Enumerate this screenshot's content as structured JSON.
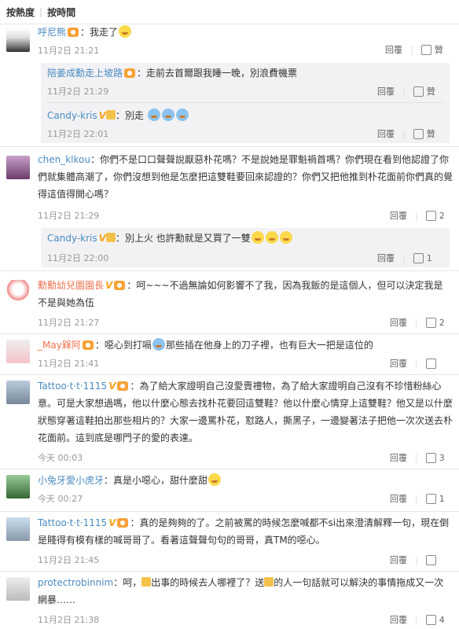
{
  "sort": {
    "hot": "按熱度",
    "time": "按時間"
  },
  "actions": {
    "reply": "回覆",
    "like": "贊"
  },
  "comments": [
    {
      "user": "呼尼熊",
      "text": "：我走了",
      "time": "11月2日 21:21",
      "likes": ""
    },
    {
      "user": "陪姜成勳走上坡路",
      "text": "：走前去首爾跟我睡一晚，別浪費機票",
      "time": "11月2日 21:29",
      "likes": ""
    },
    {
      "user": "Candy-kris",
      "text": "：別走",
      "time": "11月2日 22:01",
      "likes": ""
    },
    {
      "user": "chen_klkou",
      "text": "：你們不是口口聲聲說厭惡朴花嗎？不是說她是罪魁禍首嗎？你們現在看到他認證了你們就集體高潮了，你們沒想到他是怎麼把這雙鞋要回來認證的？你們又把他推到朴花面前你們真的覺得這值得開心嗎？",
      "time": "11月2日 21:29",
      "likes": "2"
    },
    {
      "user": "Candy-kris",
      "text": "：別上火 也許勳就是又買了一雙",
      "time": "11月2日 22:00",
      "likes": "1"
    },
    {
      "user": "勳勳幼兒園園長",
      "text": "：呵~~~不過無論如何影響不了我，因為我飯的是這個人，但可以決定我是不是與她為伍",
      "time": "11月2日 21:27",
      "likes": "2"
    },
    {
      "user": "_May槑阿",
      "text": "：噁心到打嗝",
      "text2": "那些插在他身上的刀子裡，也有巨大一把是這位的",
      "time": "11月2日 21:41",
      "likes": ""
    },
    {
      "user": "Tattoo·t·t·1115",
      "text": "：為了給大家證明自己沒愛賣禮物，為了給大家證明自己沒有不珍惜粉絲心意。可是大家想過嗎，他以什麼心態去找朴花要回這雙鞋？他以什麼心情穿上這雙鞋？他又是以什麼狀態穿著這鞋拍出那些相片的？大家一邊罵朴花，懟路人，撕黑子，一邊變著法子把他一次次送去朴花面前。這到底是哪門子的愛的表達。",
      "time": "今天 00:03",
      "likes": "3"
    },
    {
      "user": "小兔牙愛小虎牙",
      "text": "：真是小噁心，甜什麼甜",
      "time": "今天 00:27",
      "likes": "1"
    },
    {
      "user": "Tattoo·t·t·1115",
      "text": "：真的是夠夠的了。之前被罵的時候怎麼喊都不si出來澄清解釋一句，現在倒是賤得有模有樣的喊哥哥了。看著這聲聲句句的哥哥，真TM的噁心。",
      "time": "11月2日 21:45",
      "likes": ""
    },
    {
      "user": "protectrobinnim",
      "text": "：呵，",
      "text2": "出事的時候去人哪裡了？送",
      "text3": "的人一句話就可以解決的事情拖成又一次網暴……",
      "time": "11月2日 21:38",
      "likes": "4"
    }
  ]
}
